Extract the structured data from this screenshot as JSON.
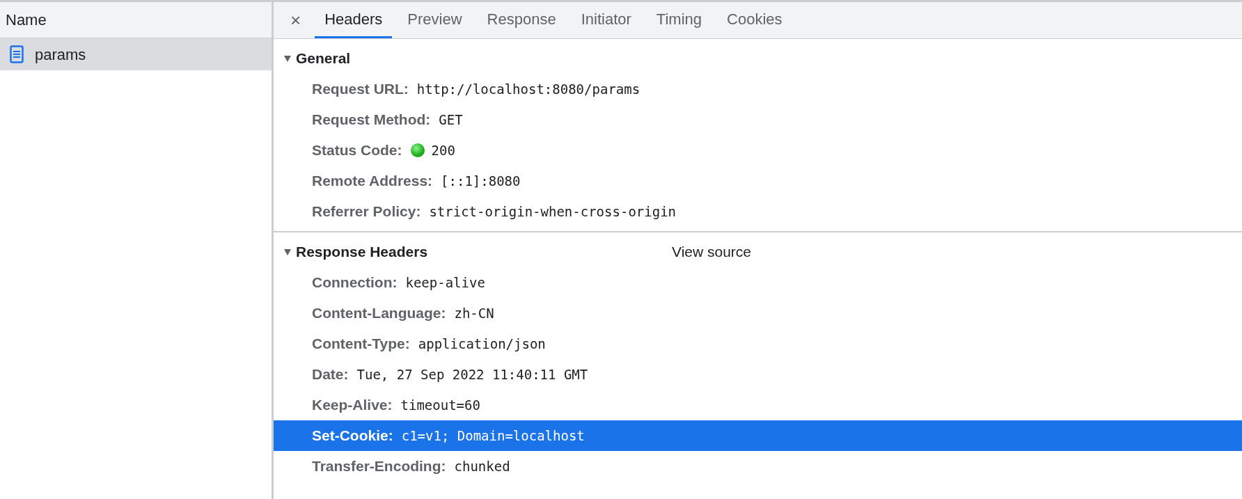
{
  "requests": {
    "column": "Name",
    "items": [
      {
        "name": "params",
        "selected": true
      }
    ]
  },
  "tabs": [
    {
      "label": "Headers",
      "selected": true
    },
    {
      "label": "Preview",
      "selected": false
    },
    {
      "label": "Response",
      "selected": false
    },
    {
      "label": "Initiator",
      "selected": false
    },
    {
      "label": "Timing",
      "selected": false
    },
    {
      "label": "Cookies",
      "selected": false
    }
  ],
  "close_icon": "×",
  "sections": [
    {
      "title": "General",
      "expanded": true,
      "rows": [
        {
          "kind": "text",
          "name": "Request URL:",
          "value": "http://localhost:8080/params",
          "selected": false
        },
        {
          "kind": "text",
          "name": "Request Method:",
          "value": "GET",
          "selected": false
        },
        {
          "kind": "status",
          "name": "Status Code:",
          "value": "200",
          "selected": false
        },
        {
          "kind": "text",
          "name": "Remote Address:",
          "value": "[::1]:8080",
          "selected": false
        },
        {
          "kind": "text",
          "name": "Referrer Policy:",
          "value": "strict-origin-when-cross-origin",
          "selected": false
        }
      ]
    },
    {
      "title": "Response Headers",
      "expanded": true,
      "link": "View source",
      "rows": [
        {
          "kind": "text",
          "name": "Connection:",
          "value": "keep-alive",
          "selected": false
        },
        {
          "kind": "text",
          "name": "Content-Language:",
          "value": "zh-CN",
          "selected": false
        },
        {
          "kind": "text",
          "name": "Content-Type:",
          "value": "application/json",
          "selected": false
        },
        {
          "kind": "text",
          "name": "Date:",
          "value": "Tue, 27 Sep 2022 11:40:11 GMT",
          "selected": false
        },
        {
          "kind": "text",
          "name": "Keep-Alive:",
          "value": "timeout=60",
          "selected": false
        },
        {
          "kind": "text",
          "name": "Set-Cookie:",
          "value": "c1=v1; Domain=localhost",
          "selected": true
        },
        {
          "kind": "text",
          "name": "Transfer-Encoding:",
          "value": "chunked",
          "selected": false
        }
      ]
    }
  ]
}
